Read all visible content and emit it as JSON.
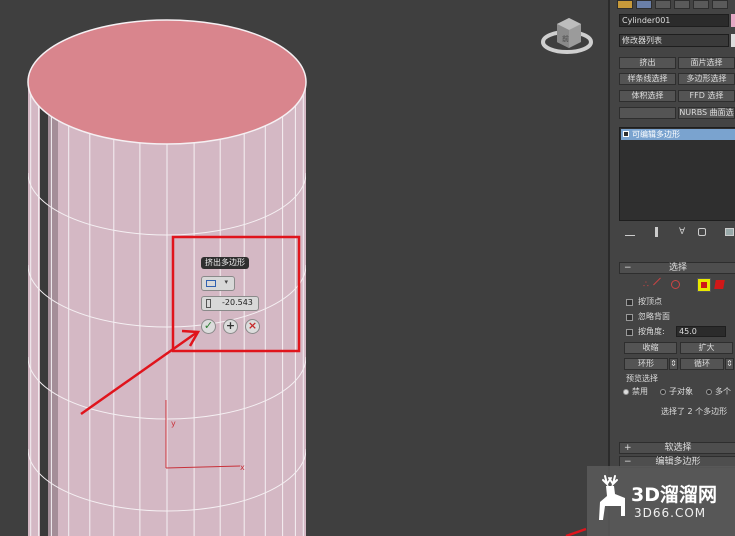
{
  "viewport": {
    "viewcube_label": "前",
    "gizmo_labels": {
      "y": "y",
      "x": "x"
    }
  },
  "caddy": {
    "title": "挤出多边形",
    "value": "-20.543"
  },
  "panel": {
    "object_name": "Cylinder001",
    "modifier_list": "修改器列表",
    "modifier_buttons": [
      "挤出",
      "面片选择",
      "样条线选择",
      "多边形选择",
      "体积选择",
      "FFD 选择",
      "",
      "NURBS 曲面选"
    ],
    "stack_item": "可编辑多边形",
    "selection": {
      "header": "选择",
      "by_vertex": "按顶点",
      "ignore_backfacing": "忽略背面",
      "by_angle": "按角度:",
      "angle_value": "45.0",
      "shrink": "收缩",
      "grow": "扩大",
      "ring": "环形",
      "loop": "循环",
      "preview_label": "预览选择",
      "preview_options": [
        "禁用",
        "子对象",
        "多个"
      ],
      "status": "选择了 2 个多边形"
    },
    "soft_selection": "软选择",
    "edit_polygons": "编辑多边形"
  },
  "watermark": {
    "brand": "3D溜溜网",
    "url": "3D66.COM"
  },
  "colors": {
    "highlight_box": "#e0141c",
    "arrow": "#e0141c",
    "cylinder_side": "#d4b8c4",
    "cylinder_top": "#d9858d",
    "stack_selected": "#7aa3cf",
    "polygon_mode": "#e8e800"
  }
}
